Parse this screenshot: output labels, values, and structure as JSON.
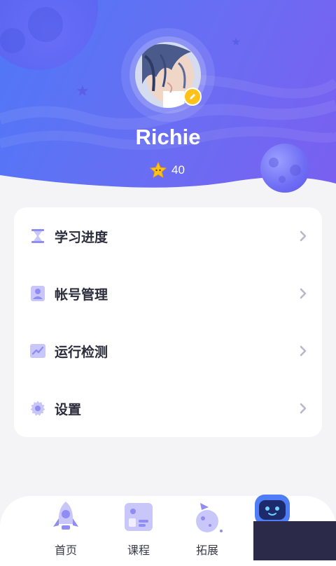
{
  "profile": {
    "username": "Richie",
    "stars_count": "40"
  },
  "menu": {
    "items": [
      {
        "label": "学习进度",
        "icon": "hourglass-icon"
      },
      {
        "label": "帐号管理",
        "icon": "user-card-icon"
      },
      {
        "label": "运行检测",
        "icon": "chart-line-icon"
      },
      {
        "label": "设置",
        "icon": "gear-icon"
      }
    ]
  },
  "nav": {
    "tabs": [
      {
        "label": "首页",
        "icon": "rocket-icon"
      },
      {
        "label": "课程",
        "icon": "course-board-icon"
      },
      {
        "label": "拓展",
        "icon": "planet-flag-icon"
      }
    ]
  },
  "colors": {
    "header_start": "#4f78f7",
    "header_end": "#7a5ff0",
    "accent": "#8f8cf2",
    "badge": "#ffc21a"
  }
}
